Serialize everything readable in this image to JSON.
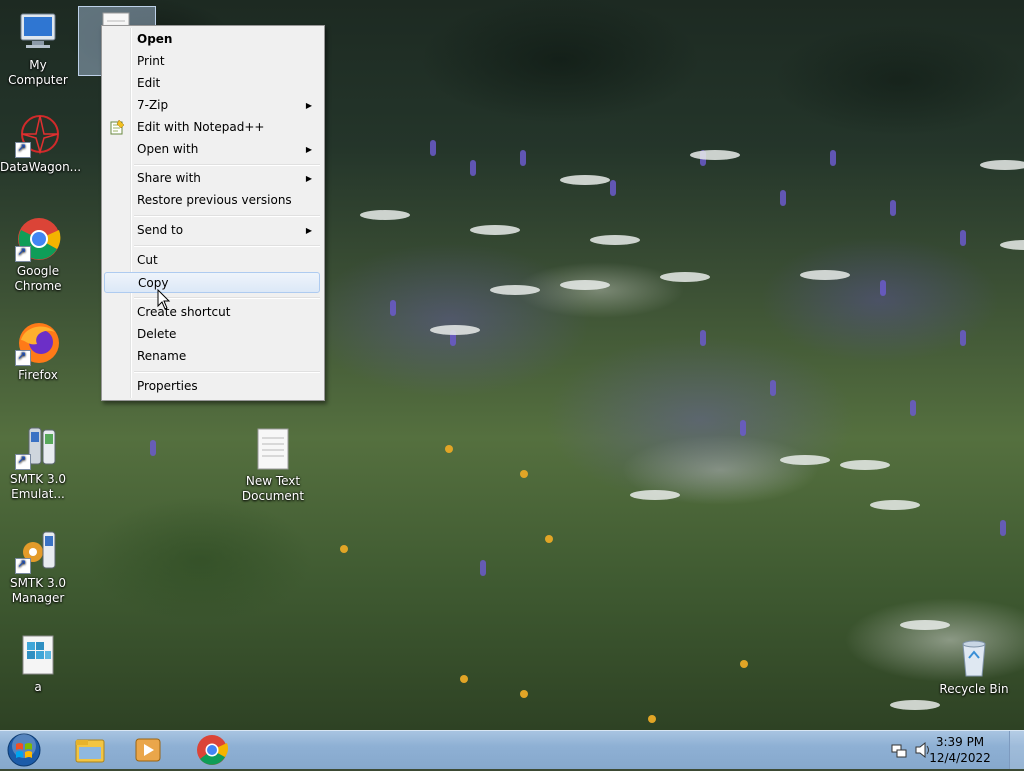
{
  "desktop": {
    "icons": [
      {
        "label": "My Computer"
      },
      {
        "label": "DataWagon..."
      },
      {
        "label": "Google Chrome"
      },
      {
        "label": "Firefox"
      },
      {
        "label": "SMTK 3.0 Emulat..."
      },
      {
        "label": "SMTK 3.0 Manager"
      },
      {
        "label": "a"
      },
      {
        "label": "New Text Document"
      },
      {
        "label": "Recycle Bin"
      }
    ]
  },
  "context_menu": {
    "items": [
      {
        "label": "Open"
      },
      {
        "label": "Print"
      },
      {
        "label": "Edit"
      },
      {
        "label": "7-Zip"
      },
      {
        "label": "Edit with Notepad++"
      },
      {
        "label": "Open with"
      },
      {
        "label": "Share with"
      },
      {
        "label": "Restore previous versions"
      },
      {
        "label": "Send to"
      },
      {
        "label": "Cut"
      },
      {
        "label": "Copy"
      },
      {
        "label": "Create shortcut"
      },
      {
        "label": "Delete"
      },
      {
        "label": "Rename"
      },
      {
        "label": "Properties"
      }
    ],
    "highlighted": "Copy"
  },
  "taskbar": {
    "pinned": [
      "windows-explorer-icon",
      "media-player-icon",
      "chrome-icon"
    ],
    "clock": {
      "time": "3:39 PM",
      "date": "12/4/2022"
    }
  }
}
